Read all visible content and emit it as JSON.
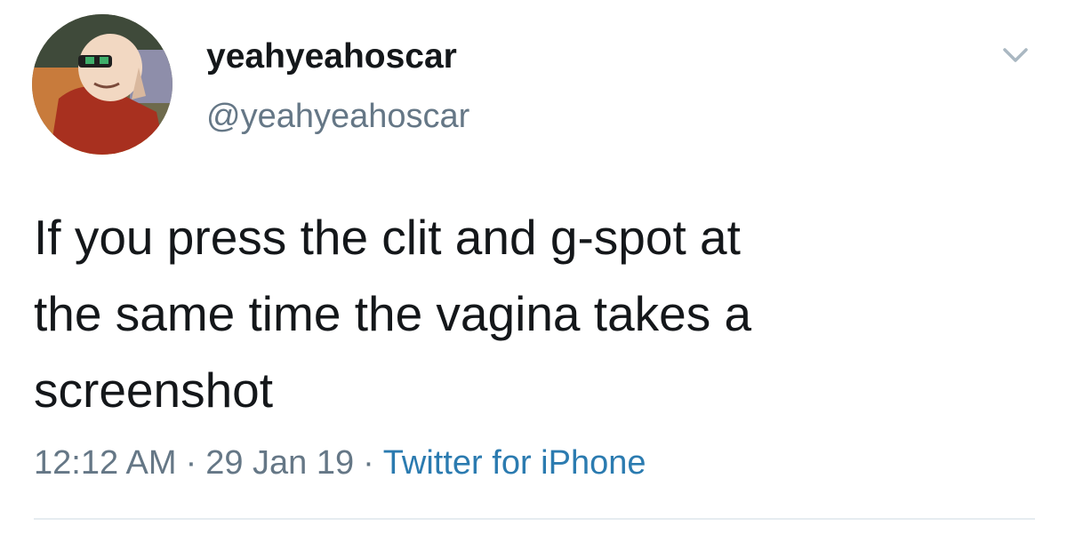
{
  "user": {
    "display_name": "yeahyeahoscar",
    "handle": "@yeahyeahoscar"
  },
  "tweet": {
    "text_lines": [
      "If you press the clit and g-spot at",
      "the same time the vagina takes a",
      "screenshot"
    ],
    "time": "12:12 AM",
    "date": "29 Jan 19",
    "source": "Twitter for iPhone",
    "separator": "·"
  },
  "icons": {
    "avatar": "cartoon-avatar-icon",
    "menu": "chevron-down-icon"
  },
  "colors": {
    "text": "#14171a",
    "secondary": "#657786",
    "link": "#2b7bb0",
    "divider": "#e6ecf0"
  }
}
